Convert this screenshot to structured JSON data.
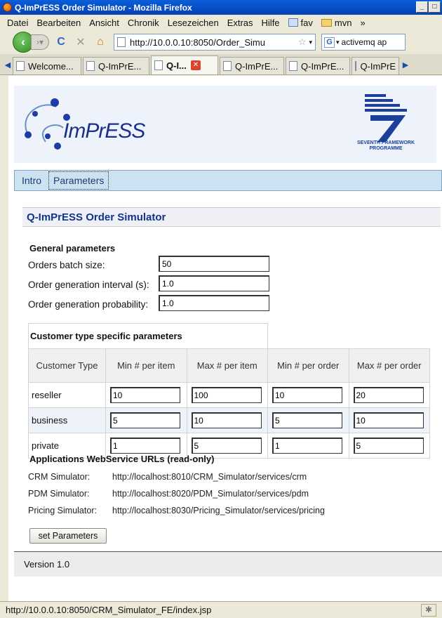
{
  "window": {
    "title": "Q-ImPrESS Order Simulator - Mozilla Firefox",
    "minimize": "_",
    "maximize": "□"
  },
  "menu": {
    "items": [
      "Datei",
      "Bearbeiten",
      "Ansicht",
      "Chronik",
      "Lesezeichen",
      "Extras",
      "Hilfe"
    ],
    "bookmarks": [
      "fav",
      "mvn"
    ],
    "overflow": "»"
  },
  "nav": {
    "url": "http://10.0.0.10:8050/Order_Simu",
    "search_value": "activemq ap"
  },
  "tabs": [
    {
      "label": "Welcome...",
      "active": false
    },
    {
      "label": "Q-ImPrE...",
      "active": false
    },
    {
      "label": "Q-I...",
      "active": true
    },
    {
      "label": "Q-ImPrE...",
      "active": false
    },
    {
      "label": "Q-ImPrE...",
      "active": false
    },
    {
      "label": "Q-ImPrE",
      "active": false
    }
  ],
  "banner": {
    "logo_text": "ImPrESS",
    "fp7_line1": "SEVENTH FRAMEWORK",
    "fp7_line2": "PROGRAMME"
  },
  "pagenav": {
    "intro": "Intro",
    "parameters": "Parameters"
  },
  "page": {
    "heading": "Q-ImPrESS Order Simulator",
    "general_title": "General parameters",
    "general": [
      {
        "label": "Orders batch size:",
        "value": "50"
      },
      {
        "label": "Order generation interval (s):",
        "value": "1.0"
      },
      {
        "label": "Order generation probability:",
        "value": "1.0"
      }
    ],
    "customer_table": {
      "caption": "Customer type specific parameters",
      "headers": [
        "Customer Type",
        "Min # per item",
        "Max # per item",
        "Min # per order",
        "Max # per order"
      ],
      "rows": [
        {
          "type": "reseller",
          "values": [
            "10",
            "100",
            "10",
            "20"
          ]
        },
        {
          "type": "business",
          "values": [
            "5",
            "10",
            "5",
            "10"
          ]
        },
        {
          "type": "private",
          "values": [
            "1",
            "5",
            "1",
            "5"
          ]
        }
      ]
    },
    "ws_title": "Applications WebService URLs (read-only)",
    "ws": [
      {
        "label": "CRM Simulator:",
        "url": "http://localhost:8010/CRM_Simulator/services/crm"
      },
      {
        "label": "PDM Simulator:",
        "url": "http://localhost:8020/PDM_Simulator/services/pdm"
      },
      {
        "label": "Pricing Simulator:",
        "url": "http://localhost:8030/Pricing_Simulator/services/pricing"
      }
    ],
    "set_button": "set Parameters",
    "footer": "Version 1.0"
  },
  "status": {
    "text": "http://10.0.0.10:8050/CRM_Simulator_FE/index.jsp"
  }
}
